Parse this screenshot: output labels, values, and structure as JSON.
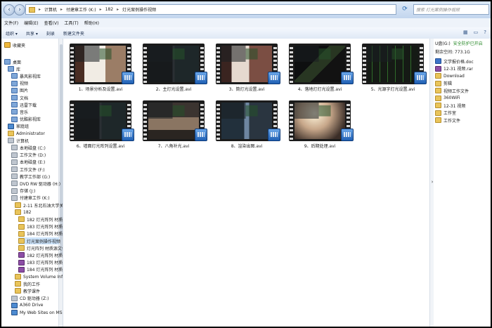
{
  "address": {
    "segments": [
      "计算机",
      "付建章工作 (K:)",
      "182",
      "灯光案例操作视频"
    ],
    "search_placeholder": "搜索 灯光案例操作视频"
  },
  "menu": [
    "文件(F)",
    "编辑(E)",
    "查看(V)",
    "工具(T)",
    "帮助(H)"
  ],
  "toolbar": [
    "组织 ▾",
    "共享 ▾",
    "刻录",
    "新建文件夹"
  ],
  "nav": [
    {
      "label": "收藏夹",
      "icon": "star-icon",
      "indent": 0
    },
    {
      "label": "桌面",
      "icon": "desktop-icon",
      "indent": 0
    },
    {
      "label": "库",
      "icon": "library-icon",
      "indent": 1
    },
    {
      "label": "暴风影视库",
      "icon": "library-icon",
      "indent": 2
    },
    {
      "label": "视频",
      "icon": "library-icon",
      "indent": 2
    },
    {
      "label": "图片",
      "icon": "library-icon",
      "indent": 2
    },
    {
      "label": "文档",
      "icon": "library-icon",
      "indent": 2
    },
    {
      "label": "迅雷下载",
      "icon": "library-icon",
      "indent": 2
    },
    {
      "label": "音乐",
      "icon": "library-icon",
      "indent": 2
    },
    {
      "label": "优酷影视库",
      "icon": "library-icon",
      "indent": 2
    },
    {
      "label": "家庭组",
      "icon": "homegroup-icon",
      "indent": 1
    },
    {
      "label": "Administrator",
      "icon": "user-icon",
      "indent": 1
    },
    {
      "label": "计算机",
      "icon": "computer-icon",
      "indent": 1
    },
    {
      "label": "本地磁盘 (C:)",
      "icon": "drive-icon",
      "indent": 2
    },
    {
      "label": "工作文件 (D:)",
      "icon": "drive-icon",
      "indent": 2
    },
    {
      "label": "本地磁盘 (E:)",
      "icon": "drive-icon",
      "indent": 2
    },
    {
      "label": "工作文件 (F:)",
      "icon": "drive-icon",
      "indent": 2
    },
    {
      "label": "教学工作部 (G:)",
      "icon": "drive-icon",
      "indent": 2
    },
    {
      "label": "DVD RW 驱动器 (H:)",
      "icon": "drive-icon",
      "indent": 2
    },
    {
      "label": "存储 (J:)",
      "icon": "drive-icon",
      "indent": 2
    },
    {
      "label": "付建章工作 (K:)",
      "icon": "drive-icon",
      "indent": 2
    },
    {
      "label": "2-11 东北石油大学关于组织",
      "icon": "folder-icon",
      "indent": 3
    },
    {
      "label": "182",
      "icon": "folder-icon",
      "indent": 3
    },
    {
      "label": "182 灯光阵列 材质源文件",
      "icon": "folder-icon",
      "indent": 4
    },
    {
      "label": "183 灯光阵列 材质源文件",
      "icon": "folder-icon",
      "indent": 4
    },
    {
      "label": "184 灯光阵列 材质源文件",
      "icon": "folder-icon",
      "indent": 4
    },
    {
      "label": "灯光案例操作视频",
      "icon": "folder-icon",
      "indent": 4,
      "selected": true
    },
    {
      "label": "灯光阵列 材质源文件",
      "icon": "folder-icon",
      "indent": 4
    },
    {
      "label": "182 灯光阵列 材质源文件",
      "icon": "rar-icon",
      "indent": 4
    },
    {
      "label": "183 灯光阵列 材质源文件",
      "icon": "rar-icon",
      "indent": 4
    },
    {
      "label": "184 灯光阵列 材质源文件",
      "icon": "rar-icon",
      "indent": 4
    },
    {
      "label": "System Volume Informatio",
      "icon": "folder-icon",
      "indent": 3
    },
    {
      "label": "我的工作",
      "icon": "folder-icon",
      "indent": 3
    },
    {
      "label": "教学课件",
      "icon": "folder-icon",
      "indent": 3
    },
    {
      "label": "CD 驱动器 (Z:)",
      "icon": "drive-icon",
      "indent": 2
    },
    {
      "label": "A360 Drive",
      "icon": "cloud-icon",
      "indent": 2
    },
    {
      "label": "My Web Sites on MSN",
      "icon": "web-icon",
      "indent": 2
    }
  ],
  "files": [
    {
      "name": "1、场景分析及设置.avi",
      "style": "s-bed"
    },
    {
      "name": "2、主灯光设置.avi",
      "style": "s-ui"
    },
    {
      "name": "3、筒灯光设置.avi",
      "style": "s-bed2"
    },
    {
      "name": "4、落地灯灯光设置.avi",
      "style": "s-night"
    },
    {
      "name": "5、光源字灯光设置.avi",
      "style": "s-green"
    },
    {
      "name": "6、墙面灯光阵列设置.avi",
      "style": "s-ui"
    },
    {
      "name": "7、八角补光.avi",
      "style": "s-room"
    },
    {
      "name": "8、渲染出图.avi",
      "style": "s-blue"
    },
    {
      "name": "9、后期处理.avi",
      "style": "s-lamp"
    }
  ],
  "rpane": {
    "drive": "U盘(G:)",
    "safe_label": "安全防护已开启",
    "space": "剩余空间: 773.1G",
    "items": [
      {
        "label": "文学报价格.doc",
        "icon": "doc-icon"
      },
      {
        "label": "12-31 视频.rar",
        "icon": "rar-icon"
      },
      {
        "label": "Download",
        "icon": "folder-icon"
      },
      {
        "label": "剪辑",
        "icon": "folder-icon"
      },
      {
        "label": "视频工作文件",
        "icon": "folder-icon"
      },
      {
        "label": "360WiFi",
        "icon": "folder-icon"
      },
      {
        "label": "12-31 视频",
        "icon": "folder-icon"
      },
      {
        "label": "工作室",
        "icon": "folder-icon"
      },
      {
        "label": "工作文件",
        "icon": "folder-icon"
      }
    ]
  }
}
